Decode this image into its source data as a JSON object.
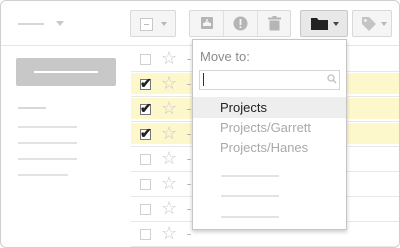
{
  "toolbar": {
    "buttons": [
      {
        "name": "select",
        "icon": "checkbox-icon"
      },
      {
        "name": "archive",
        "icon": "archive-icon"
      },
      {
        "name": "report-spam",
        "icon": "alert-icon"
      },
      {
        "name": "delete",
        "icon": "trash-icon"
      },
      {
        "name": "move-to",
        "icon": "folder-icon"
      },
      {
        "name": "labels",
        "icon": "tag-icon"
      }
    ]
  },
  "message_list": {
    "rows": [
      {
        "checked": false,
        "highlighted": false
      },
      {
        "checked": true,
        "highlighted": true
      },
      {
        "checked": true,
        "highlighted": true
      },
      {
        "checked": true,
        "highlighted": true
      },
      {
        "checked": false,
        "highlighted": false
      },
      {
        "checked": false,
        "highlighted": false
      },
      {
        "checked": false,
        "highlighted": false
      },
      {
        "checked": false,
        "highlighted": false
      }
    ]
  },
  "move_menu": {
    "title": "Move to:",
    "search_value": "",
    "items": [
      {
        "label": "Projects",
        "state": "active"
      },
      {
        "label": "Projects/Garrett",
        "state": "dim"
      },
      {
        "label": "Projects/Hanes",
        "state": "dim"
      }
    ]
  },
  "colors": {
    "selected_row": "#fdf7cc",
    "compose": "#c8c8c8",
    "menu_highlight": "#eeeeee"
  }
}
